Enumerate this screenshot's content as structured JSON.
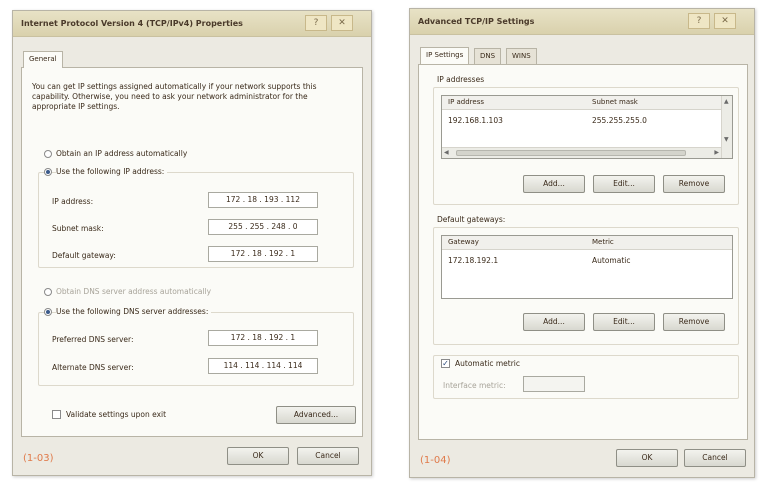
{
  "left_dialog": {
    "title": "Internet Protocol Version 4 (TCP/IPv4) Properties",
    "help_button": "?",
    "close_button": "✕",
    "tab_general": "General",
    "intro_text": "You can get IP settings assigned automatically if your network supports this capability. Otherwise, you need to ask your network administrator for the appropriate IP settings.",
    "radio_obtain_ip": "Obtain an IP address automatically",
    "radio_use_ip": "Use the following IP address:",
    "ip_address_label": "IP address:",
    "ip_address_value": "172 . 18 . 193 . 112",
    "subnet_mask_label": "Subnet mask:",
    "subnet_mask_value": "255 . 255 . 248 . 0",
    "default_gateway_label": "Default gateway:",
    "default_gateway_value": "172 . 18 . 192 . 1",
    "radio_obtain_dns": "Obtain DNS server address automatically",
    "radio_use_dns": "Use the following DNS server addresses:",
    "preferred_dns_label": "Preferred DNS server:",
    "preferred_dns_value": "172 . 18 . 192 . 1",
    "alternate_dns_label": "Alternate DNS server:",
    "alternate_dns_value": "114 . 114 . 114 . 114",
    "validate_label": "Validate settings upon exit",
    "advanced_button": "Advanced...",
    "ok_button": "OK",
    "cancel_button": "Cancel",
    "caption": "(1-03)"
  },
  "right_dialog": {
    "title": "Advanced TCP/IP Settings",
    "help_button": "?",
    "close_button": "✕",
    "tabs": [
      "IP Settings",
      "DNS",
      "WINS"
    ],
    "ip_addresses_label": "IP addresses",
    "ip_columns": [
      "IP address",
      "Subnet mask"
    ],
    "ip_rows": [
      [
        "192.168.1.103",
        "255.255.255.0"
      ]
    ],
    "add_button_1": "Add...",
    "edit_button_1": "Edit...",
    "remove_button_1": "Remove",
    "default_gateways_label": "Default gateways:",
    "gw_columns": [
      "Gateway",
      "Metric"
    ],
    "gw_rows": [
      [
        "172.18.192.1",
        "Automatic"
      ]
    ],
    "add_button_2": "Add...",
    "edit_button_2": "Edit...",
    "remove_button_2": "Remove",
    "automatic_metric_label": "Automatic metric",
    "interface_metric_label": "Interface metric:",
    "ok_button": "OK",
    "cancel_button": "Cancel",
    "caption": "(1-04)"
  },
  "colors": {
    "caption": "#e07a4a",
    "dialog_bg": "#eceae2",
    "panel_bg": "#fbfbf7",
    "titlebar": "#ddd5b2"
  }
}
